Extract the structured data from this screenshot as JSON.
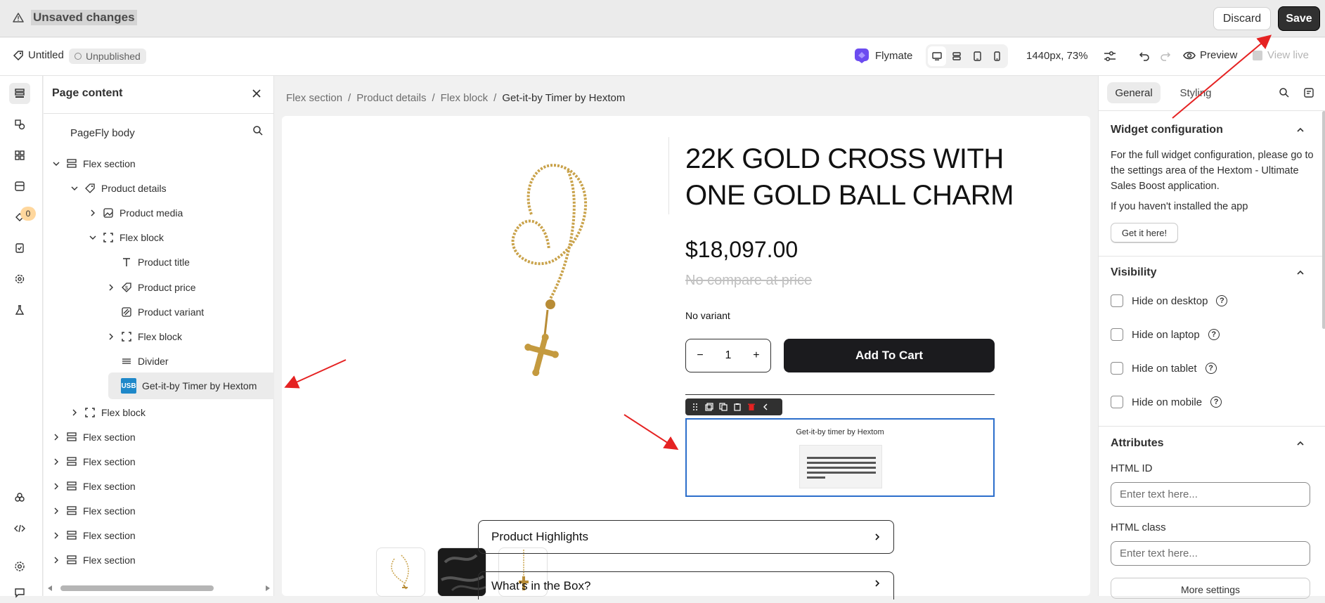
{
  "topbar": {
    "status": "Unsaved changes",
    "discard": "Discard",
    "save": "Save"
  },
  "toolbar": {
    "page_name": "Untitled",
    "publish_status": "Unpublished",
    "brand": "Flymate",
    "viewport": "1440px, 73%",
    "preview": "Preview",
    "view_live": "View live"
  },
  "page_panel": {
    "title": "Page content",
    "root": "PageFly body",
    "tree": [
      {
        "label": "Flex section",
        "icon": "section-icon",
        "level": 0,
        "chevron": "down"
      },
      {
        "label": "Product details",
        "icon": "tag-icon",
        "level": 1,
        "chevron": "down"
      },
      {
        "label": "Product media",
        "icon": "image-icon",
        "level": 2,
        "chevron": "right"
      },
      {
        "label": "Flex block",
        "icon": "block-icon",
        "level": 2,
        "chevron": "down"
      },
      {
        "label": "Product title",
        "icon": "text-icon",
        "level": 3,
        "chevron": ""
      },
      {
        "label": "Product price",
        "icon": "price-icon",
        "level": 3,
        "chevron": "right"
      },
      {
        "label": "Product variant",
        "icon": "variant-icon",
        "level": 3,
        "chevron": ""
      },
      {
        "label": "Flex block",
        "icon": "block-icon",
        "level": 3,
        "chevron": "right"
      },
      {
        "label": "Divider",
        "icon": "divider-icon",
        "level": 3,
        "chevron": ""
      },
      {
        "label": "Get-it-by Timer by Hextom",
        "icon": "usb-app-icon",
        "level": 3,
        "chevron": "",
        "selected": true
      },
      {
        "label": "Flex block",
        "icon": "block-icon",
        "level": 1,
        "chevron": "right"
      },
      {
        "label": "Flex section",
        "icon": "section-icon",
        "level": 0,
        "chevron": "right"
      },
      {
        "label": "Flex section",
        "icon": "section-icon",
        "level": 0,
        "chevron": "right"
      },
      {
        "label": "Flex section",
        "icon": "section-icon",
        "level": 0,
        "chevron": "right"
      },
      {
        "label": "Flex section",
        "icon": "section-icon",
        "level": 0,
        "chevron": "right"
      },
      {
        "label": "Flex section",
        "icon": "section-icon",
        "level": 0,
        "chevron": "right"
      },
      {
        "label": "Flex section",
        "icon": "section-icon",
        "level": 0,
        "chevron": "right"
      }
    ],
    "usb_badge": "USB",
    "notification_count": "0"
  },
  "breadcrumb": [
    "Flex section",
    "Product details",
    "Flex block",
    "Get-it-by Timer by Hextom"
  ],
  "product": {
    "title_line1": "22K GOLD CROSS WITH",
    "title_line2": "ONE GOLD BALL CHARM",
    "price": "$18,097.00",
    "compare_price": "No compare at price",
    "variant": "No variant",
    "quantity": "1",
    "minus": "−",
    "plus": "+",
    "add_to_cart": "Add To Cart",
    "widget_title": "Get-it-by timer by Hextom",
    "accordions": [
      "Product Highlights",
      "What’s in the Box?"
    ]
  },
  "right_panel": {
    "tabs": [
      "General",
      "Styling"
    ],
    "widget_config": {
      "title": "Widget configuration",
      "desc": "For the full widget configuration, please go to the settings area of the Hextom - Ultimate Sales Boost application.",
      "not_installed": "If you haven't installed the app",
      "cta": "Get it here!"
    },
    "visibility": {
      "title": "Visibility",
      "options": [
        "Hide on desktop",
        "Hide on laptop",
        "Hide on tablet",
        "Hide on mobile"
      ]
    },
    "attributes": {
      "title": "Attributes",
      "html_id_label": "HTML ID",
      "html_id_placeholder": "Enter text here...",
      "html_class_label": "HTML class",
      "html_class_placeholder": "Enter text here...",
      "more": "More settings"
    }
  },
  "colors": {
    "accent": "#2c6ecb",
    "dark": "#303030",
    "annotation": "#e52222",
    "brand": "#6c4cf0"
  }
}
